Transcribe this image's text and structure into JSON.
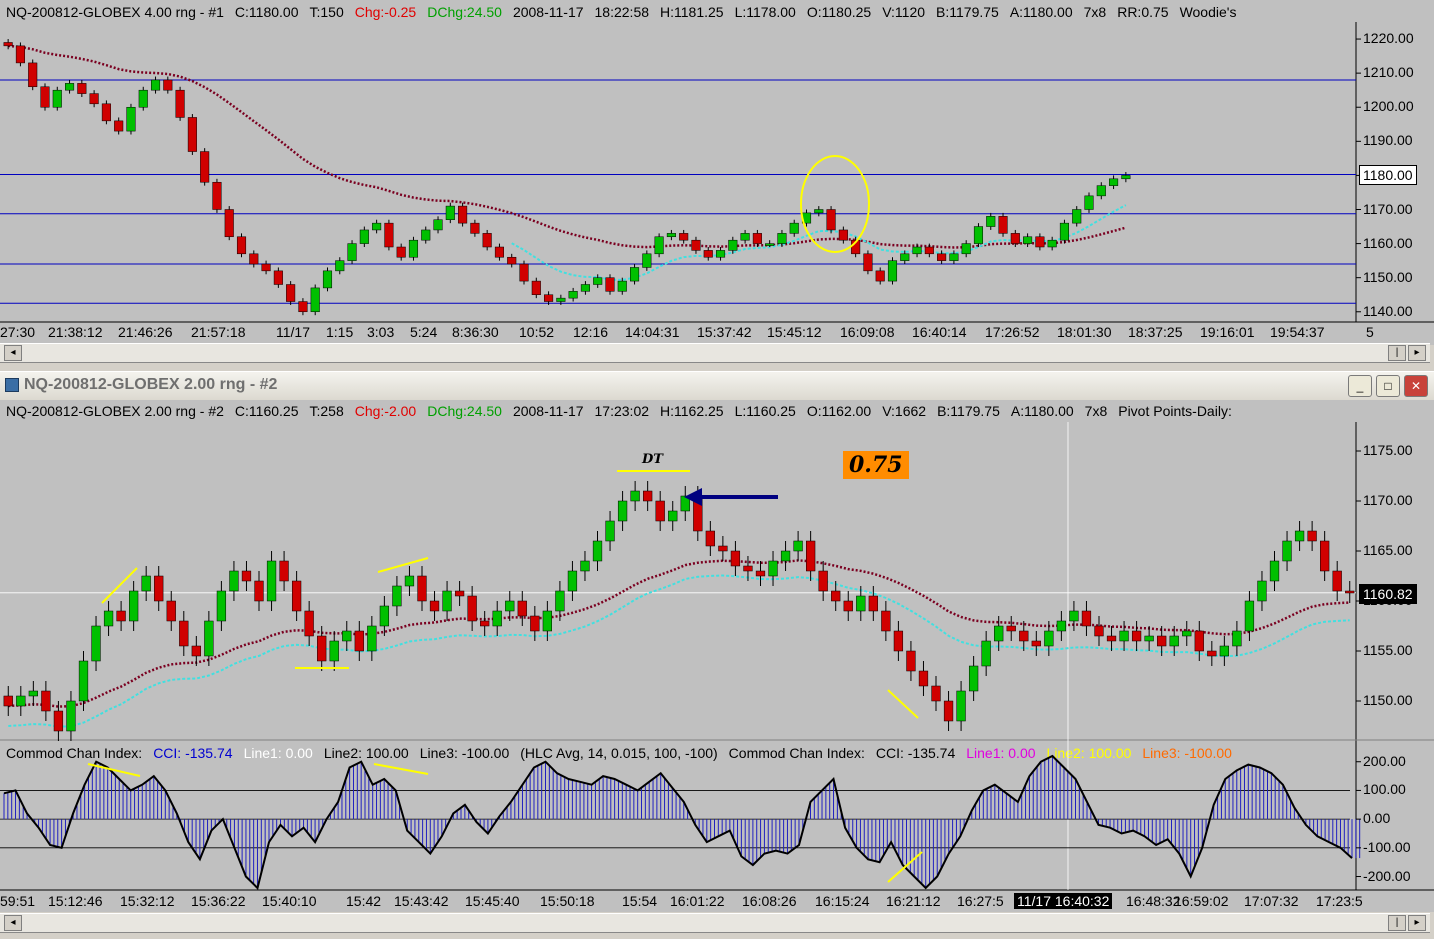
{
  "top": {
    "header": {
      "symbol": "NQ-200812-GLOBEX 4.00 rng - #1",
      "close": "C:1180.00",
      "ticks": "T:150",
      "chg": "Chg:-0.25",
      "dchg": "DChg:24.50",
      "date": "2008-11-17",
      "time": "18:22:58",
      "high": "H:1181.25",
      "low": "L:1178.00",
      "open": "O:1180.25",
      "vol": "V:1120",
      "bid": "B:1179.75",
      "ask": "A:1180.00",
      "size": "7x8",
      "rr": "RR:0.75",
      "indicator": "Woodie's"
    },
    "price_axis": [
      "1220.00",
      "1210.00",
      "1200.00",
      "1190.00",
      "1180.00",
      "1170.00",
      "1160.00",
      "1150.00",
      "1140.00"
    ],
    "last_price": "1180.00",
    "time_axis": [
      "27:30",
      "21:38:12",
      "21:46:26",
      "21:57:18",
      "11/17",
      "1:15",
      "3:03",
      "5:24",
      "8:36:30",
      "10:52",
      "12:16",
      "14:04:31",
      "15:37:42",
      "15:45:12",
      "16:09:08",
      "16:40:14",
      "17:26:52",
      "18:01:30",
      "18:37:25",
      "19:16:01",
      "19:54:37",
      "5"
    ]
  },
  "window": {
    "title": "NQ-200812-GLOBEX  2.00 rng - #2",
    "minimize": "_",
    "restore": "□",
    "close": "✕"
  },
  "bottom": {
    "header": {
      "symbol": "NQ-200812-GLOBEX 2.00 rng - #2",
      "close": "C:1160.25",
      "ticks": "T:258",
      "chg": "Chg:-2.00",
      "dchg": "DChg:24.50",
      "date": "2008-11-17",
      "time": "17:23:02",
      "high": "H:1162.25",
      "low": "L:1160.25",
      "open": "O:1162.00",
      "vol": "V:1662",
      "bid": "B:1179.75",
      "ask": "A:1180.00",
      "size": "7x8",
      "indicator": "Pivot Points-Daily:"
    },
    "price_axis": [
      "1175.00",
      "1170.00",
      "1165.00",
      "1160.00",
      "1155.00",
      "1150.00"
    ],
    "last_price": "1160.82",
    "cci_header": {
      "name": "Commod Chan Index:",
      "cci": "CCI: -135.74",
      "line1": "Line1: 0.00",
      "line2": "Line2: 100.00",
      "line3": "Line3: -100.00",
      "params": "(HLC Avg, 14, 0.015, 100, -100)",
      "name2": "Commod Chan Index:",
      "cci2": "CCI: -135.74",
      "line1b": "Line1: 0.00",
      "line2b": "Line2: 100.00",
      "line3b": "Line3: -100.00"
    },
    "cci_axis": [
      "200.00",
      "100.00",
      "0.00",
      "-100.00",
      "-200.00"
    ],
    "time_axis": [
      "59:51",
      "15:12:46",
      "15:32:12",
      "15:36:22",
      "15:40:10",
      "15:42",
      "15:43:42",
      "15:45:40",
      "15:50:18",
      "15:54",
      "16:01:22",
      "16:08:26",
      "16:15:24",
      "16:21:12",
      "16:27:5",
      "16:48:32",
      "16:59:02",
      "17:07:32",
      "17:23:5"
    ],
    "cursor_time": "11/17  16:40:32",
    "annotation_dt": "DT",
    "annotation_value": "0.75"
  },
  "colors": {
    "background": "#c0c0c0",
    "up_bar": "#00c000",
    "down_bar": "#d00000",
    "ma_slow": "#7a0020",
    "ma_fast": "#40e0e0",
    "pivot_line": "#0000c0",
    "annotation": "#ffff00",
    "arrow": "#000080",
    "badge": "#ff8c00"
  },
  "chart_data": [
    {
      "type": "candlestick",
      "title": "NQ-200812-GLOBEX 4.00 rng - #1",
      "ylim": [
        1137,
        1225
      ],
      "pivot_levels": [
        1208,
        1180.25,
        1168.75,
        1154,
        1142.5
      ],
      "close_path": [
        1218,
        1213,
        1206,
        1200,
        1205,
        1207,
        1204,
        1201,
        1196,
        1193,
        1200,
        1205,
        1208,
        1205,
        1197,
        1187,
        1178,
        1170,
        1162,
        1157,
        1154,
        1152,
        1148,
        1143,
        1140,
        1147,
        1152,
        1155,
        1160,
        1164,
        1166,
        1159,
        1156,
        1161,
        1164,
        1167,
        1171,
        1166,
        1163,
        1159,
        1156,
        1154,
        1149,
        1145,
        1143,
        1144,
        1146,
        1148,
        1150,
        1146,
        1149,
        1153,
        1157,
        1162,
        1163,
        1161,
        1158,
        1156,
        1158,
        1161,
        1163,
        1160,
        1160,
        1163,
        1166,
        1169,
        1170,
        1164,
        1161,
        1157,
        1152,
        1149,
        1155,
        1157,
        1159,
        1157,
        1155,
        1157,
        1160,
        1165,
        1168,
        1163,
        1160,
        1162,
        1159,
        1161,
        1166,
        1170,
        1174,
        1177,
        1179,
        1180
      ]
    },
    {
      "type": "candlestick",
      "title": "NQ-200812-GLOBEX 2.00 rng - #2",
      "ylim": [
        1146.5,
        1177.5
      ],
      "close_path": [
        1149.5,
        1150.5,
        1151,
        1149,
        1147,
        1150,
        1154,
        1157.5,
        1159,
        1158,
        1161,
        1162.5,
        1160,
        1158,
        1155.5,
        1154.5,
        1158,
        1161,
        1163,
        1162,
        1160,
        1164,
        1162,
        1159,
        1156.5,
        1154,
        1156,
        1157,
        1155,
        1157.5,
        1159.5,
        1161.5,
        1162.5,
        1160,
        1159,
        1161,
        1160.5,
        1158,
        1157.5,
        1159,
        1160,
        1158.5,
        1157,
        1159,
        1161,
        1163,
        1164,
        1166,
        1168,
        1170,
        1171,
        1170,
        1168,
        1169,
        1170.5,
        1167,
        1165.5,
        1165,
        1163.5,
        1163,
        1162.5,
        1164,
        1165,
        1166,
        1163,
        1161,
        1160,
        1159,
        1160.5,
        1159,
        1157,
        1155,
        1153,
        1151.5,
        1150,
        1148,
        1151,
        1153.5,
        1156,
        1157.5,
        1157,
        1156,
        1155.5,
        1157,
        1158,
        1159,
        1157.5,
        1156.5,
        1156,
        1157,
        1156,
        1156.5,
        1155.5,
        1156.5,
        1157,
        1155,
        1154.5,
        1155.5,
        1157,
        1160,
        1162,
        1164,
        1166,
        1167,
        1166,
        1163,
        1161,
        1160.8
      ]
    },
    {
      "type": "area",
      "title": "Commod Chan Index",
      "ylim": [
        -240,
        220
      ],
      "reference_lines": [
        0,
        100,
        -100
      ],
      "values": [
        90,
        100,
        20,
        -30,
        -90,
        -100,
        20,
        120,
        200,
        180,
        140,
        100,
        120,
        150,
        100,
        20,
        -80,
        -140,
        -40,
        0,
        -100,
        -200,
        -240,
        -80,
        -20,
        -60,
        -30,
        -80,
        0,
        60,
        180,
        200,
        120,
        140,
        100,
        -40,
        -80,
        -120,
        -60,
        20,
        50,
        -10,
        -50,
        10,
        60,
        120,
        180,
        200,
        160,
        140,
        130,
        120,
        150,
        140,
        120,
        100,
        130,
        160,
        110,
        60,
        -20,
        -80,
        -60,
        -40,
        -130,
        -160,
        -120,
        -110,
        -120,
        -90,
        60,
        100,
        140,
        -30,
        -100,
        -140,
        -150,
        -80,
        -160,
        -200,
        -240,
        -200,
        -120,
        -60,
        30,
        100,
        120,
        90,
        60,
        150,
        200,
        220,
        180,
        140,
        60,
        -20,
        -30,
        -50,
        -40,
        -60,
        -90,
        -70,
        -120,
        -200,
        -100,
        50,
        140,
        170,
        190,
        180,
        160,
        120,
        40,
        -20,
        -60,
        -80,
        -100,
        -135.74
      ]
    }
  ]
}
